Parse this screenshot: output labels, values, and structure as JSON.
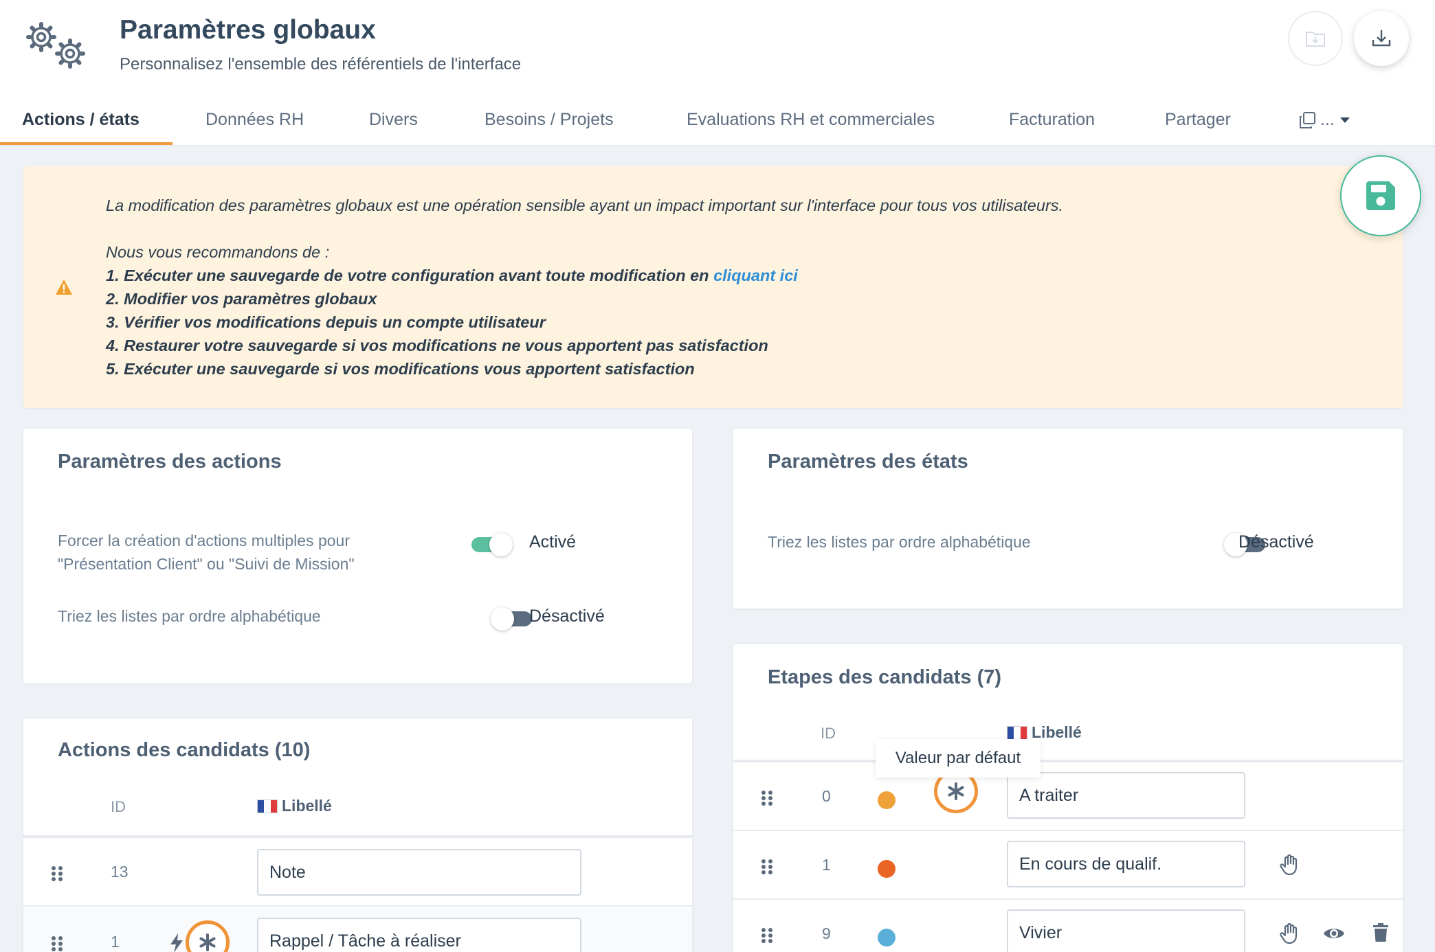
{
  "header": {
    "title": "Paramètres globaux",
    "subtitle": "Personnalisez l'ensemble des référentiels de l'interface"
  },
  "tabs": [
    {
      "label": "Actions / états",
      "active": true
    },
    {
      "label": "Données RH"
    },
    {
      "label": "Divers"
    },
    {
      "label": "Besoins / Projets"
    },
    {
      "label": "Evaluations RH et commerciales"
    },
    {
      "label": "Facturation"
    },
    {
      "label": "Partager"
    }
  ],
  "tab_more_label": "...",
  "warning": {
    "intro": "La modification des paramètres globaux est une opération sensible ayant un impact important sur l'interface pour tous vos utilisateurs.",
    "recommend": "Nous vous recommandons de :",
    "step1": "1. Exécuter une sauvegarde de votre configuration avant toute modification en ",
    "step1_link": "cliquant ici",
    "step2": "2. Modifier vos paramètres globaux",
    "step3": "3. Vérifier vos modifications depuis un compte utilisateur",
    "step4": "4. Restaurer votre sauvegarde si vos modifications ne vous apportent pas satisfaction",
    "step5": "5. Exécuter une sauvegarde si vos modifications vous apportent satisfaction"
  },
  "actions_params": {
    "title": "Paramètres des actions",
    "force_multi_label": "Forcer la création d'actions multiples pour \"Présentation Client\" ou \"Suivi de Mission\"",
    "force_multi_state": "Activé",
    "sort_label": "Triez les listes par ordre alphabétique",
    "sort_state": "Désactivé"
  },
  "states_params": {
    "title": "Paramètres des états",
    "sort_label": "Triez les listes par ordre alphabétique",
    "sort_state": "Désactivé"
  },
  "candidate_actions": {
    "title": "Actions des candidats (10)",
    "col_id": "ID",
    "col_label": "Libellé",
    "rows": [
      {
        "id": "13",
        "label": "Note"
      },
      {
        "id": "1",
        "label": "Rappel / Tâche à réaliser"
      }
    ]
  },
  "candidate_steps": {
    "title": "Etapes des candidats (7)",
    "col_id": "ID",
    "col_label": "Libellé",
    "tooltip": "Valeur par défaut",
    "rows": [
      {
        "id": "0",
        "label": "A traiter",
        "color": "#f0a23a"
      },
      {
        "id": "1",
        "label": "En cours de qualif.",
        "color": "#ea6424"
      },
      {
        "id": "9",
        "label": "Vivier",
        "color": "#5aafd9"
      }
    ]
  },
  "colors": {
    "accent_orange": "#f09a3e",
    "toggle_on": "#5cc0a0",
    "save_green": "#48b999",
    "warning_bg": "#fdf3de"
  }
}
